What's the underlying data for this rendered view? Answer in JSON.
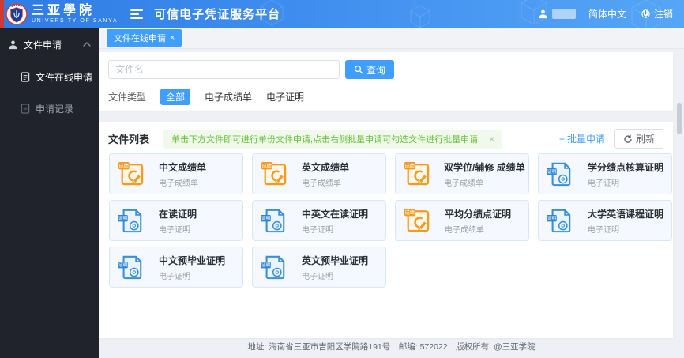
{
  "header": {
    "school_name": "三亚學院",
    "school_name_en": "UNIVERSITY OF SANYA",
    "platform_title": "可信电子凭证服务平台",
    "language": "简体中文",
    "logout_label": "注销"
  },
  "sidebar": {
    "parent_label": "文件申请",
    "items": [
      {
        "label": "文件在线申请",
        "active": true
      },
      {
        "label": "申请记录",
        "active": false
      }
    ]
  },
  "tabs": [
    {
      "label": "文件在线申请",
      "close_glyph": "×"
    }
  ],
  "search": {
    "placeholder": "文件名",
    "button_label": "查询"
  },
  "filter": {
    "label": "文件类型",
    "options": [
      "全部",
      "电子成绩单",
      "电子证明"
    ],
    "selected": "全部"
  },
  "file_list": {
    "title": "文件列表",
    "notice": "单击下方文件即可进行单份文件申请,点击右侧批量申请可勾选文件进行批量申请",
    "notice_close_glyph": "×",
    "batch_button": "批量申请",
    "batch_plus_glyph": "+",
    "refresh_button": "刷新",
    "cards": [
      {
        "title": "中文成绩单",
        "subtitle": "电子成绩单",
        "icon": "transcript-icon"
      },
      {
        "title": "英文成绩单",
        "subtitle": "电子成绩单",
        "icon": "transcript-icon"
      },
      {
        "title": "双学位/辅修 成绩单",
        "subtitle": "电子成绩单",
        "icon": "transcript-icon"
      },
      {
        "title": "学分绩点核算证明",
        "subtitle": "电子证明",
        "icon": "certificate-icon"
      },
      {
        "title": "在读证明",
        "subtitle": "电子证明",
        "icon": "certificate-icon"
      },
      {
        "title": "中英文在读证明",
        "subtitle": "电子证明",
        "icon": "certificate-icon"
      },
      {
        "title": "平均分绩点证明",
        "subtitle": "电子成绩单",
        "icon": "transcript-icon"
      },
      {
        "title": "大学英语课程证明",
        "subtitle": "电子证明",
        "icon": "certificate-icon"
      },
      {
        "title": "中文预毕业证明",
        "subtitle": "电子证明",
        "icon": "certificate-icon"
      },
      {
        "title": "英文预毕业证明",
        "subtitle": "电子证明",
        "icon": "certificate-icon"
      }
    ]
  },
  "footer": {
    "text": "地址: 海南省三亚市吉阳区学院路191号　邮编: 572022　版权所有: @三亚学院"
  },
  "colors": {
    "accent": "#409eff",
    "header_gradient_start": "#2e7ce4",
    "header_gradient_end": "#55a6f6",
    "sidebar_bg": "#20232b",
    "success_text": "#67c23a",
    "success_bg": "#f0f9eb",
    "transcript_icon": "#f59a23",
    "certificate_icon": "#3a8fd9",
    "red_strip": "#cf3b33"
  }
}
